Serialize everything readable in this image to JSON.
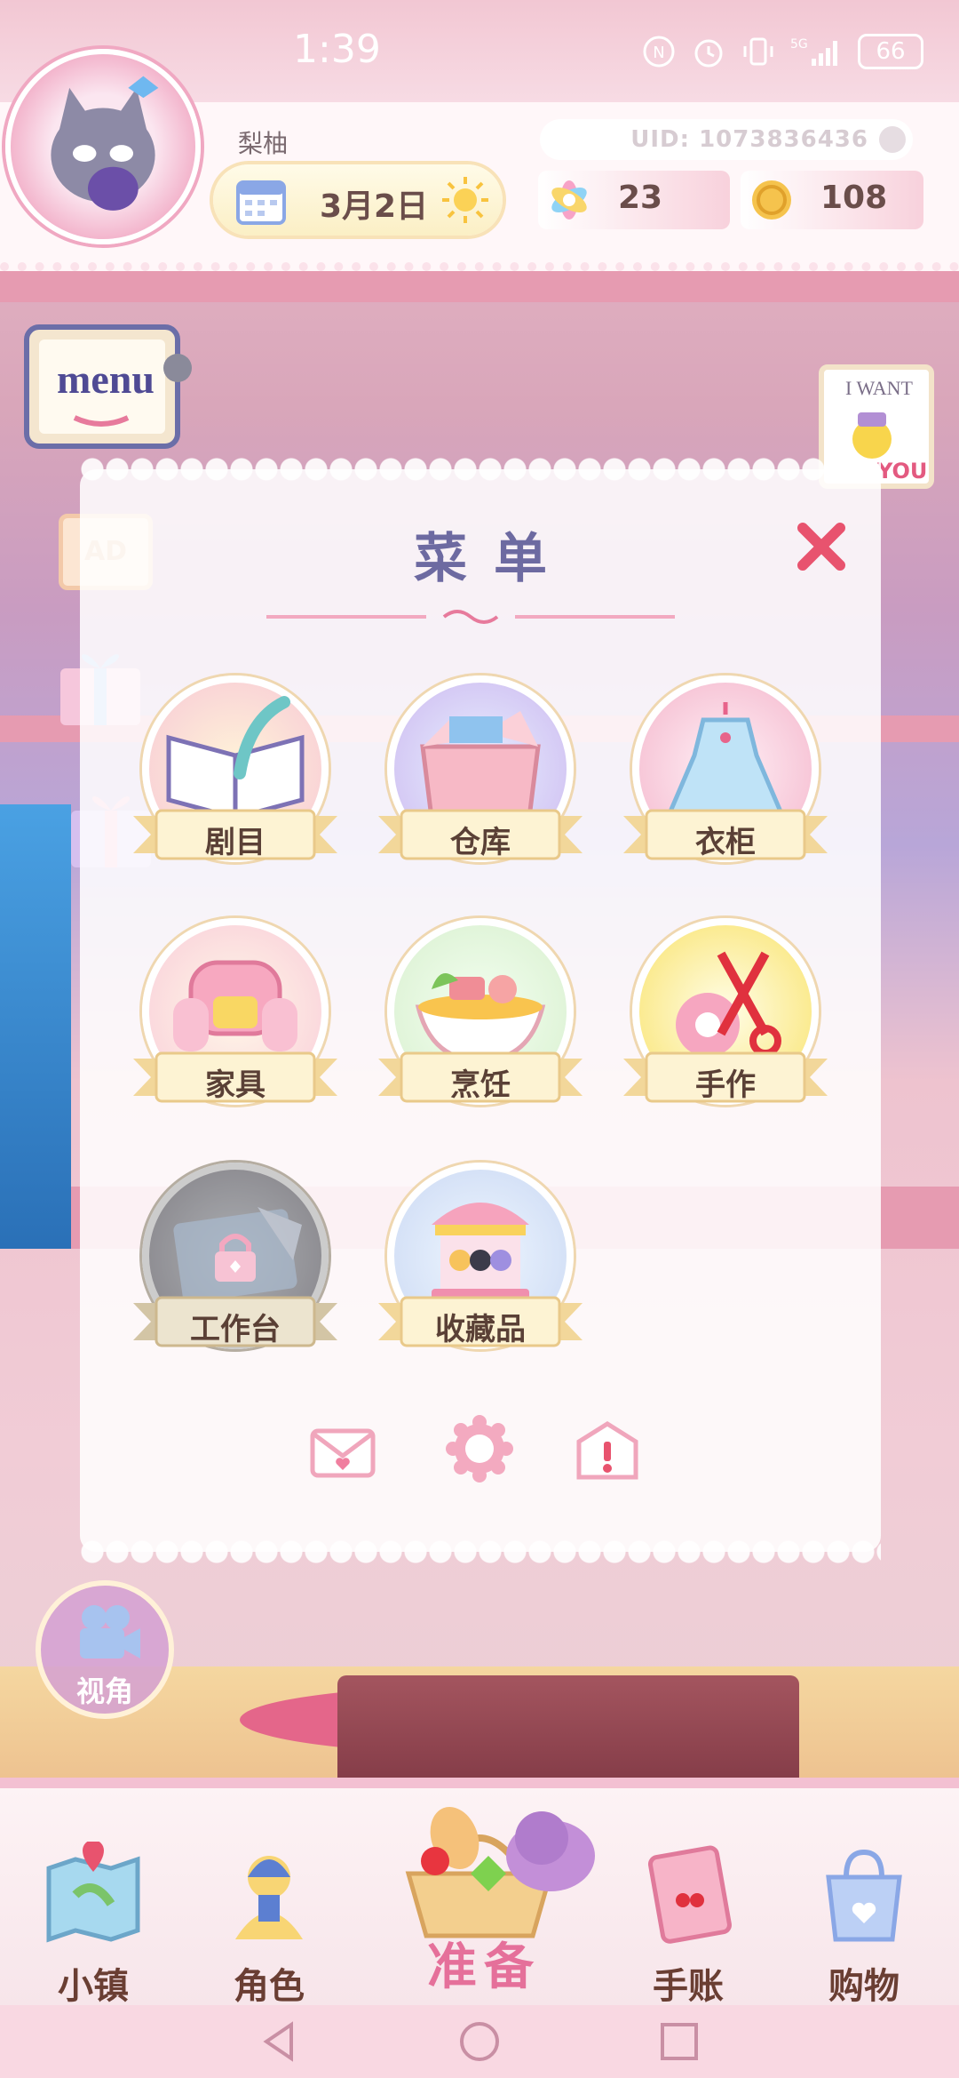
{
  "status_bar": {
    "time": "1:39",
    "battery": "66",
    "icons": [
      "nfc-icon",
      "alarm-icon",
      "vibrate-icon",
      "signal-5g-icon"
    ]
  },
  "hud": {
    "player_name": "梨柚",
    "uid": "UID: 1073836436",
    "date": "3月2日",
    "weather_icon": "sun-icon",
    "gems": "23",
    "coins": "108"
  },
  "side": {
    "menu_button_label": "menu",
    "ad_label": "AD",
    "want_you_line1": "I WANT",
    "want_you_line2": "YOU",
    "view_label": "视角"
  },
  "menu": {
    "title": "菜单",
    "items": [
      {
        "label": "剧目",
        "icon": "script-book-icon",
        "locked": false
      },
      {
        "label": "仓库",
        "icon": "storage-box-icon",
        "locked": false
      },
      {
        "label": "衣柜",
        "icon": "dress-icon",
        "locked": false
      },
      {
        "label": "家具",
        "icon": "armchair-icon",
        "locked": false
      },
      {
        "label": "烹饪",
        "icon": "cooking-bowl-icon",
        "locked": false
      },
      {
        "label": "手作",
        "icon": "scissors-tape-icon",
        "locked": false
      },
      {
        "label": "工作台",
        "icon": "workbench-icon",
        "locked": true
      },
      {
        "label": "收藏品",
        "icon": "carousel-icon",
        "locked": false
      }
    ],
    "footer_icons": [
      "mail-icon",
      "settings-gear-icon",
      "notice-icon"
    ]
  },
  "bottom_nav": {
    "tabs": [
      {
        "label": "小镇",
        "icon": "town-map-icon"
      },
      {
        "label": "角色",
        "icon": "character-icon"
      },
      {
        "label": "准备",
        "icon": "basket-hat-icon"
      },
      {
        "label": "手账",
        "icon": "journal-icon"
      },
      {
        "label": "购物",
        "icon": "shopping-bag-icon"
      }
    ]
  },
  "colors": {
    "accent_pink": "#e5709a",
    "title_purple": "#6d6aa1",
    "close_red": "#e8536e",
    "label_brown": "#5a4036"
  }
}
